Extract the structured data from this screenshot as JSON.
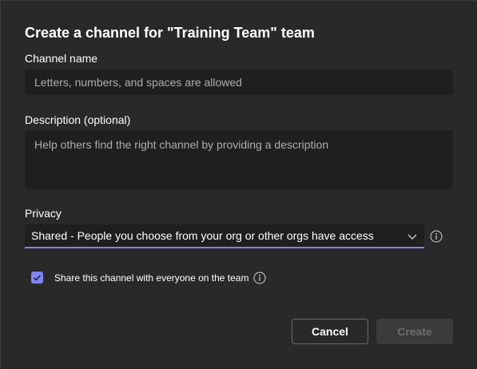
{
  "dialog": {
    "title": "Create a channel for \"Training Team\" team"
  },
  "channel_name": {
    "label": "Channel name",
    "placeholder": "Letters, numbers, and spaces are allowed",
    "value": ""
  },
  "description": {
    "label": "Description (optional)",
    "placeholder": "Help others find the right channel by providing a description",
    "value": ""
  },
  "privacy": {
    "label": "Privacy",
    "selected": "Shared - People you choose from your org or other orgs have access"
  },
  "share_option": {
    "label": "Share this channel with everyone on the team",
    "checked": true
  },
  "actions": {
    "cancel_label": "Cancel",
    "create_label": "Create",
    "create_enabled": false
  },
  "colors": {
    "background": "#292929",
    "field_background": "#1f1f1f",
    "accent": "#7f85f5",
    "text": "#ffffff",
    "placeholder": "#adadad",
    "disabled_text": "#6e6e6e"
  },
  "icons": {
    "privacy_info": "info-icon",
    "share_info": "info-icon",
    "dropdown": "chevron-down-icon",
    "checkbox": "checkmark-icon"
  }
}
